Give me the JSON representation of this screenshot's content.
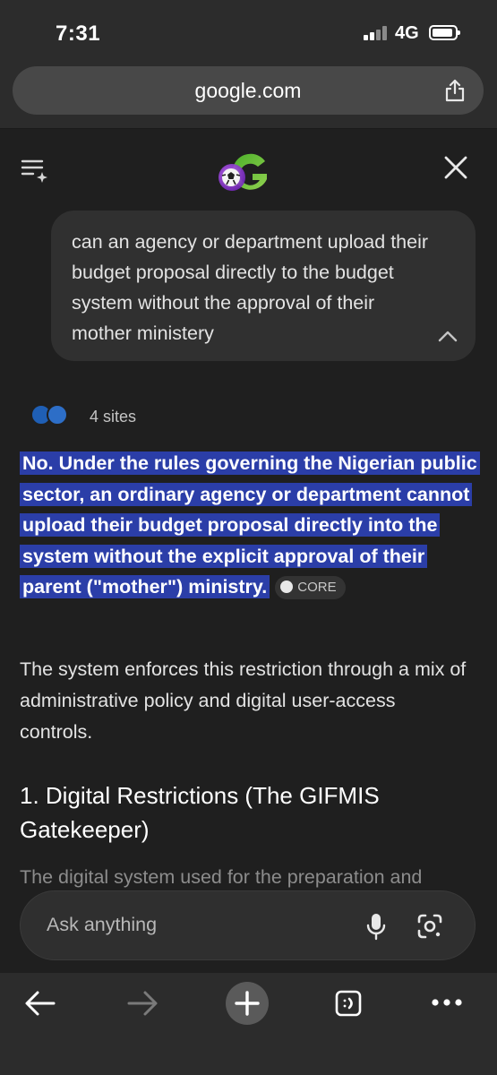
{
  "status_bar": {
    "time": "7:31",
    "network": "4G"
  },
  "browser": {
    "url": "google.com"
  },
  "conversation": {
    "query": "can an agency or department upload their budget proposal directly to the budget system without the approval of their mother ministery",
    "sources_label": "4 sites",
    "answer_bold": "No. Under the rules governing the Nigerian public sector, an ordinary agency or department cannot upload their budget proposal directly into the system without the explicit approval of their parent (\"mother\") ministry.",
    "citation_chip": "CORE",
    "answer_paragraph": "The system enforces this restriction through a mix of administrative policy and digital user-access controls.",
    "section_heading": "1. Digital Restrictions (The GIFMIS Gatekeeper)",
    "faded_paragraph": "The digital system used for the preparation and"
  },
  "input": {
    "placeholder": "Ask anything"
  },
  "colors": {
    "background": "#1f1f1f",
    "chrome": "#2c2c2c",
    "highlight": "#2b3ea8",
    "bubble": "#303030"
  },
  "icons": [
    "menu-icon",
    "gemini-logo",
    "close-icon",
    "chevron-up-icon",
    "share-icon",
    "mic-icon",
    "lens-icon",
    "back-icon",
    "forward-icon",
    "plus-icon",
    "tabs-icon",
    "more-icon"
  ]
}
